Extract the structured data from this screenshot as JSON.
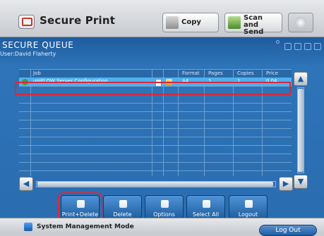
{
  "header": {
    "title": "Secure Print",
    "copy_label": "Copy",
    "scan_label_line1": "Scan and",
    "scan_label_line2": "Send",
    "icons": [
      "secure-print-icon",
      "copy-icon",
      "scan-send-icon",
      "system-icon"
    ]
  },
  "queue": {
    "title": "SECURE QUEUE",
    "user_text": "User:David Flaherty",
    "columns": [
      "Job",
      "Format",
      "Pages",
      "Copies",
      "Price"
    ],
    "rows": [
      {
        "job": "uniFLOW Server Configuration",
        "format": "A4",
        "pages": "1",
        "copies": "1",
        "price": "0.04"
      }
    ],
    "colors": {
      "panel": "#2e74b8",
      "selected_row": "#4fb0ef",
      "highlight": "#d9293a"
    }
  },
  "actions": {
    "print_delete": "Print+Delete",
    "delete": "Delete",
    "options": "Options",
    "select_all": "Select All",
    "logout": "Logout"
  },
  "status": {
    "mode_text": "System Management Mode",
    "logout_label": "Log Out"
  }
}
